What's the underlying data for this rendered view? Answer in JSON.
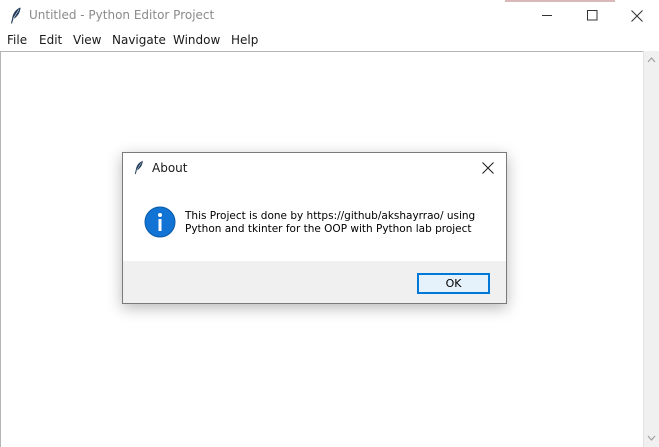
{
  "window": {
    "title": "Untitled - Python Editor Project",
    "controls": {
      "minimize": "minimize-icon",
      "maximize": "maximize-icon",
      "close": "close-icon"
    }
  },
  "menubar": {
    "items": [
      {
        "label": "File"
      },
      {
        "label": "Edit"
      },
      {
        "label": "View"
      },
      {
        "label": "Navigate"
      },
      {
        "label": "Window"
      },
      {
        "label": "Help"
      }
    ]
  },
  "editor": {
    "content": ""
  },
  "dialog": {
    "title": "About",
    "icon": "info-icon",
    "message_lines": [
      "This Project is done by https://github/akshayrrao/ using",
      "Python and tkinter for the OOP with Python lab project"
    ],
    "ok_label": "OK"
  },
  "colors": {
    "accent": "#0078d7",
    "info_icon": "#1173d4",
    "footer_bg": "#f0f0f0",
    "ok_bg": "#e5f1fb"
  }
}
